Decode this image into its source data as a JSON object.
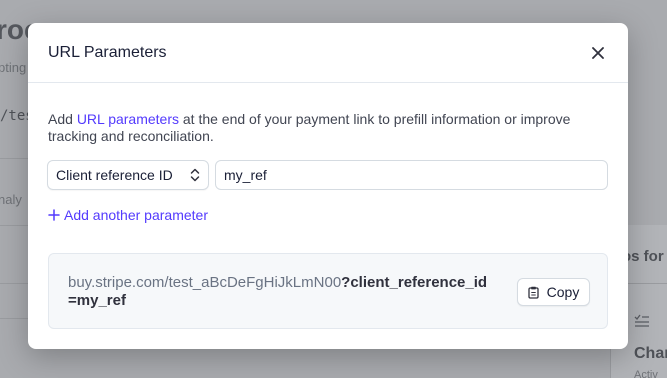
{
  "background": {
    "title_fragment": "roc",
    "subtitle_fragment": "pting",
    "code_fragment": "/tes",
    "analytics_fragment": "naly",
    "right_heading_fragment": "os for",
    "right_icon": "checklist-icon",
    "right_title_fragment": "Char",
    "right_sub_fragment": "Activ"
  },
  "modal": {
    "title": "URL Parameters",
    "close_icon": "close-icon",
    "description_prefix": "Add ",
    "description_link": "URL parameters",
    "description_suffix": " at the end of your payment link to prefill information or improve tracking and reconciliation.",
    "parameter": {
      "selected": "Client reference ID",
      "value": "my_ref"
    },
    "add_parameter_label": "Add another parameter",
    "url": {
      "base": "buy.stripe.com/test_aBcDeFgHiJkLmN00",
      "query": "?client_reference_id=my_ref"
    },
    "copy_label": "Copy"
  },
  "colors": {
    "accent": "#533afd",
    "overlay": "#a9abaf"
  }
}
